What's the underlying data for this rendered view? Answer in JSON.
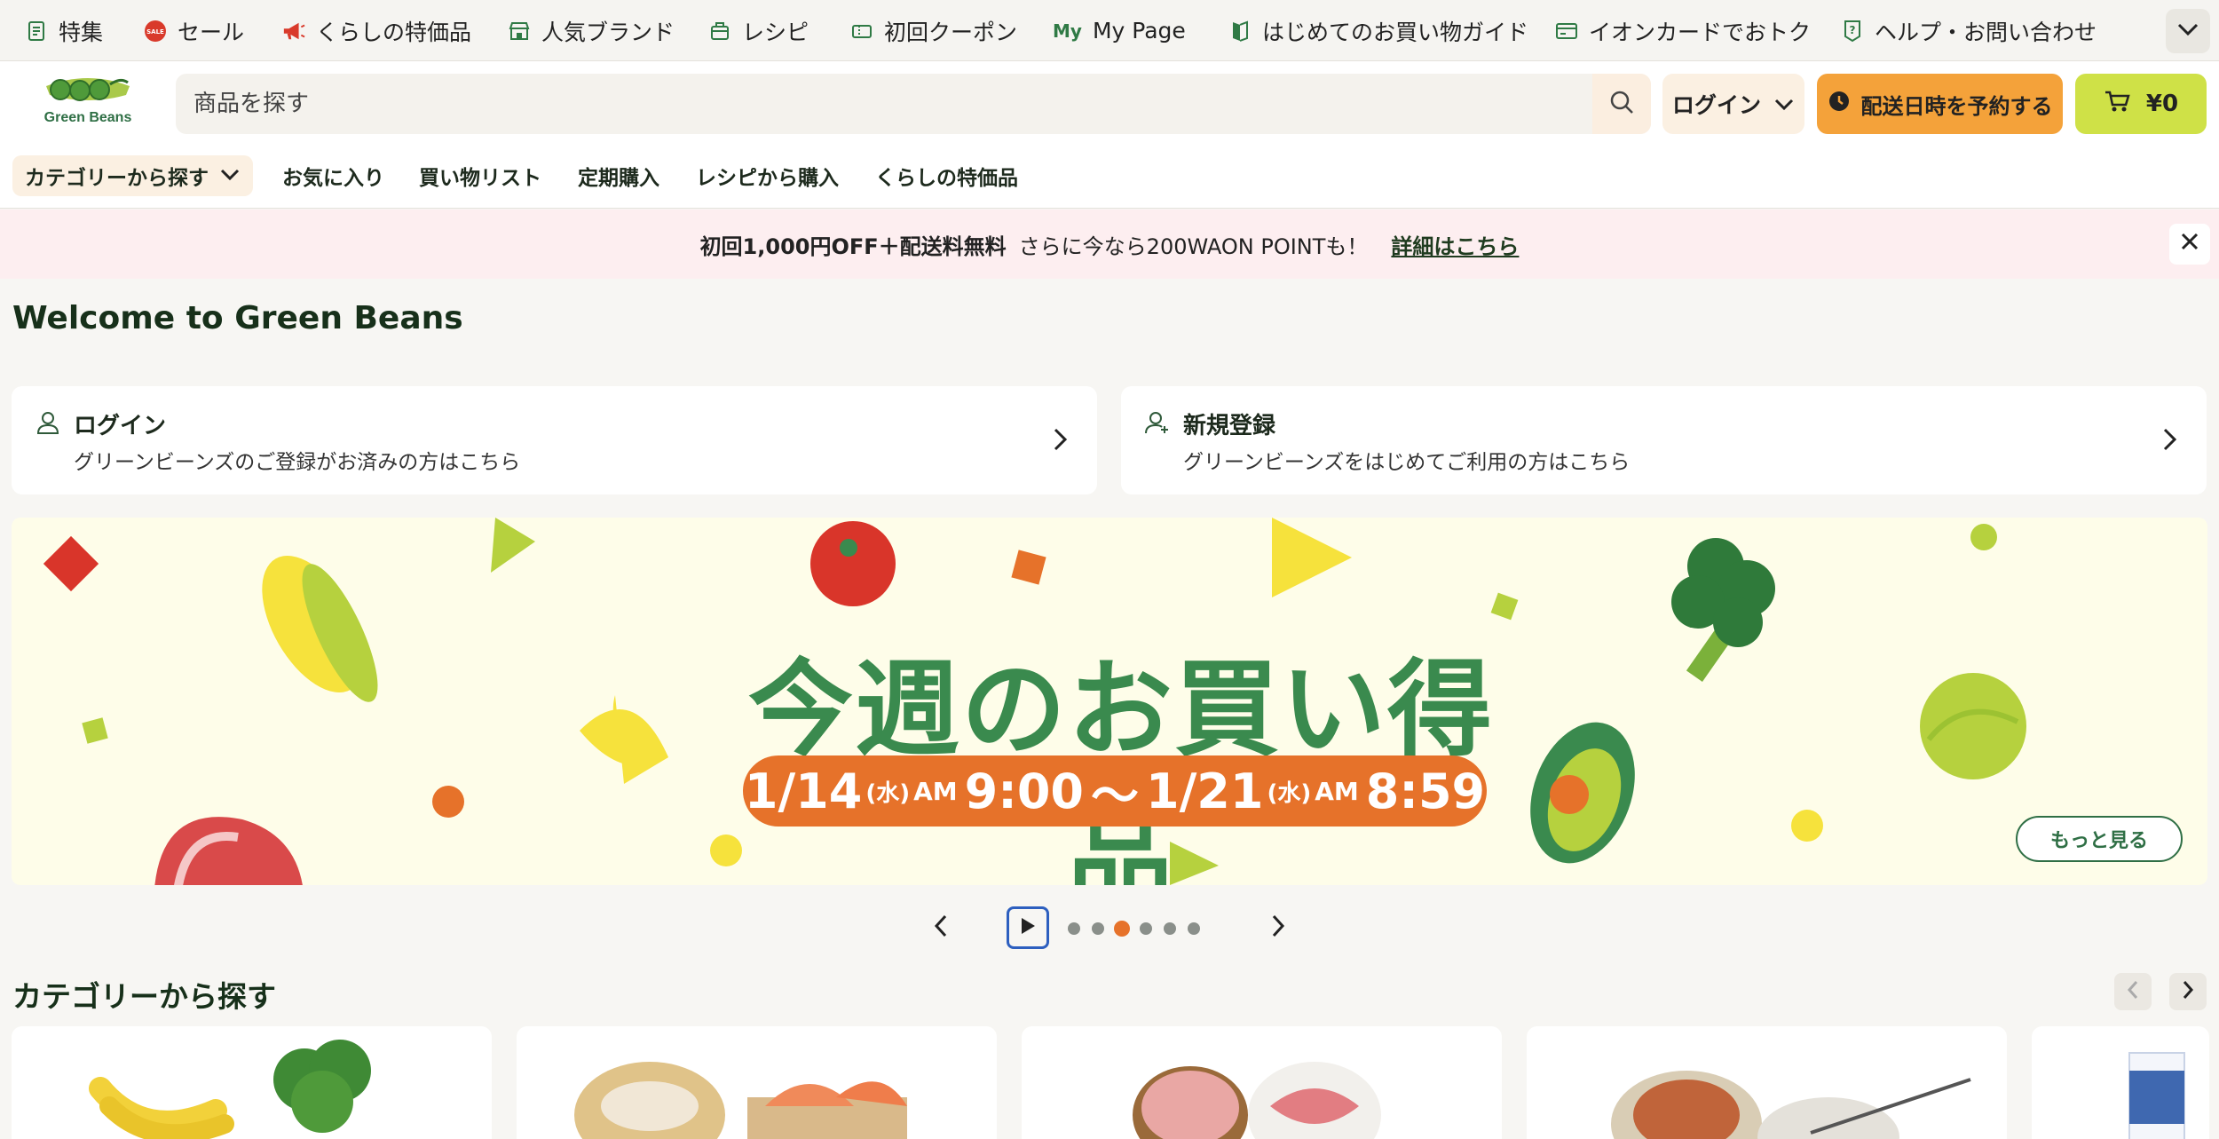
{
  "topnav": {
    "items": [
      {
        "label": "特集",
        "icon": "document-icon"
      },
      {
        "label": "セール",
        "icon": "sale-badge-icon"
      },
      {
        "label": "くらしの特価品",
        "icon": "megaphone-icon"
      },
      {
        "label": "人気ブランド",
        "icon": "store-icon"
      },
      {
        "label": "レシピ",
        "icon": "recipe-box-icon"
      },
      {
        "label": "初回クーポン",
        "icon": "coupon-icon"
      },
      {
        "label": "My Page",
        "icon_text": "My"
      },
      {
        "label": "はじめてのお買い物ガイド",
        "icon": "guide-book-icon"
      },
      {
        "label": "イオンカードでおトク",
        "icon": "card-icon"
      },
      {
        "label": "ヘルプ・お問い合わせ",
        "icon": "help-icon"
      }
    ]
  },
  "header": {
    "logo_text": "Green Beans",
    "search_placeholder": "商品を探す",
    "login_label": "ログイン",
    "reserve_label": "配送日時を予約する",
    "cart_amount": "¥0"
  },
  "catnav": {
    "items": [
      "カテゴリーから探す",
      "お気に入り",
      "買い物リスト",
      "定期購入",
      "レシピから購入",
      "くらしの特価品"
    ]
  },
  "promo": {
    "bold_text": "初回1,000円OFF＋配送料無料",
    "text": "さらに今なら200WAON POINTも！",
    "link": "詳細はこちら"
  },
  "welcome": {
    "title": "Welcome to Green Beans",
    "login_card": {
      "title": "ログイン",
      "subtitle": "グリーンビーンズのご登録がお済みの方はこちら"
    },
    "register_card": {
      "title": "新規登録",
      "subtitle": "グリーンビーンズをはじめてご利用の方はこちら"
    }
  },
  "banner": {
    "title": "今週のお買い得品",
    "date_start": "1/14",
    "date_start_day": "(水)",
    "date_start_ampm": "AM",
    "date_start_time": "9:00",
    "date_sep": "〜",
    "date_end": "1/21",
    "date_end_day": "(水)",
    "date_end_ampm": "AM",
    "date_end_time": "8:59",
    "more_label": "もっと見る"
  },
  "carousel": {
    "slide_count": 6,
    "active_index": 2
  },
  "categories": {
    "heading": "カテゴリーから探す"
  },
  "colors": {
    "brand_green": "#3a8a4e",
    "accent_orange": "#f4a23a",
    "cart_lime": "#cfe147",
    "promo_pink": "#fdeef0"
  }
}
